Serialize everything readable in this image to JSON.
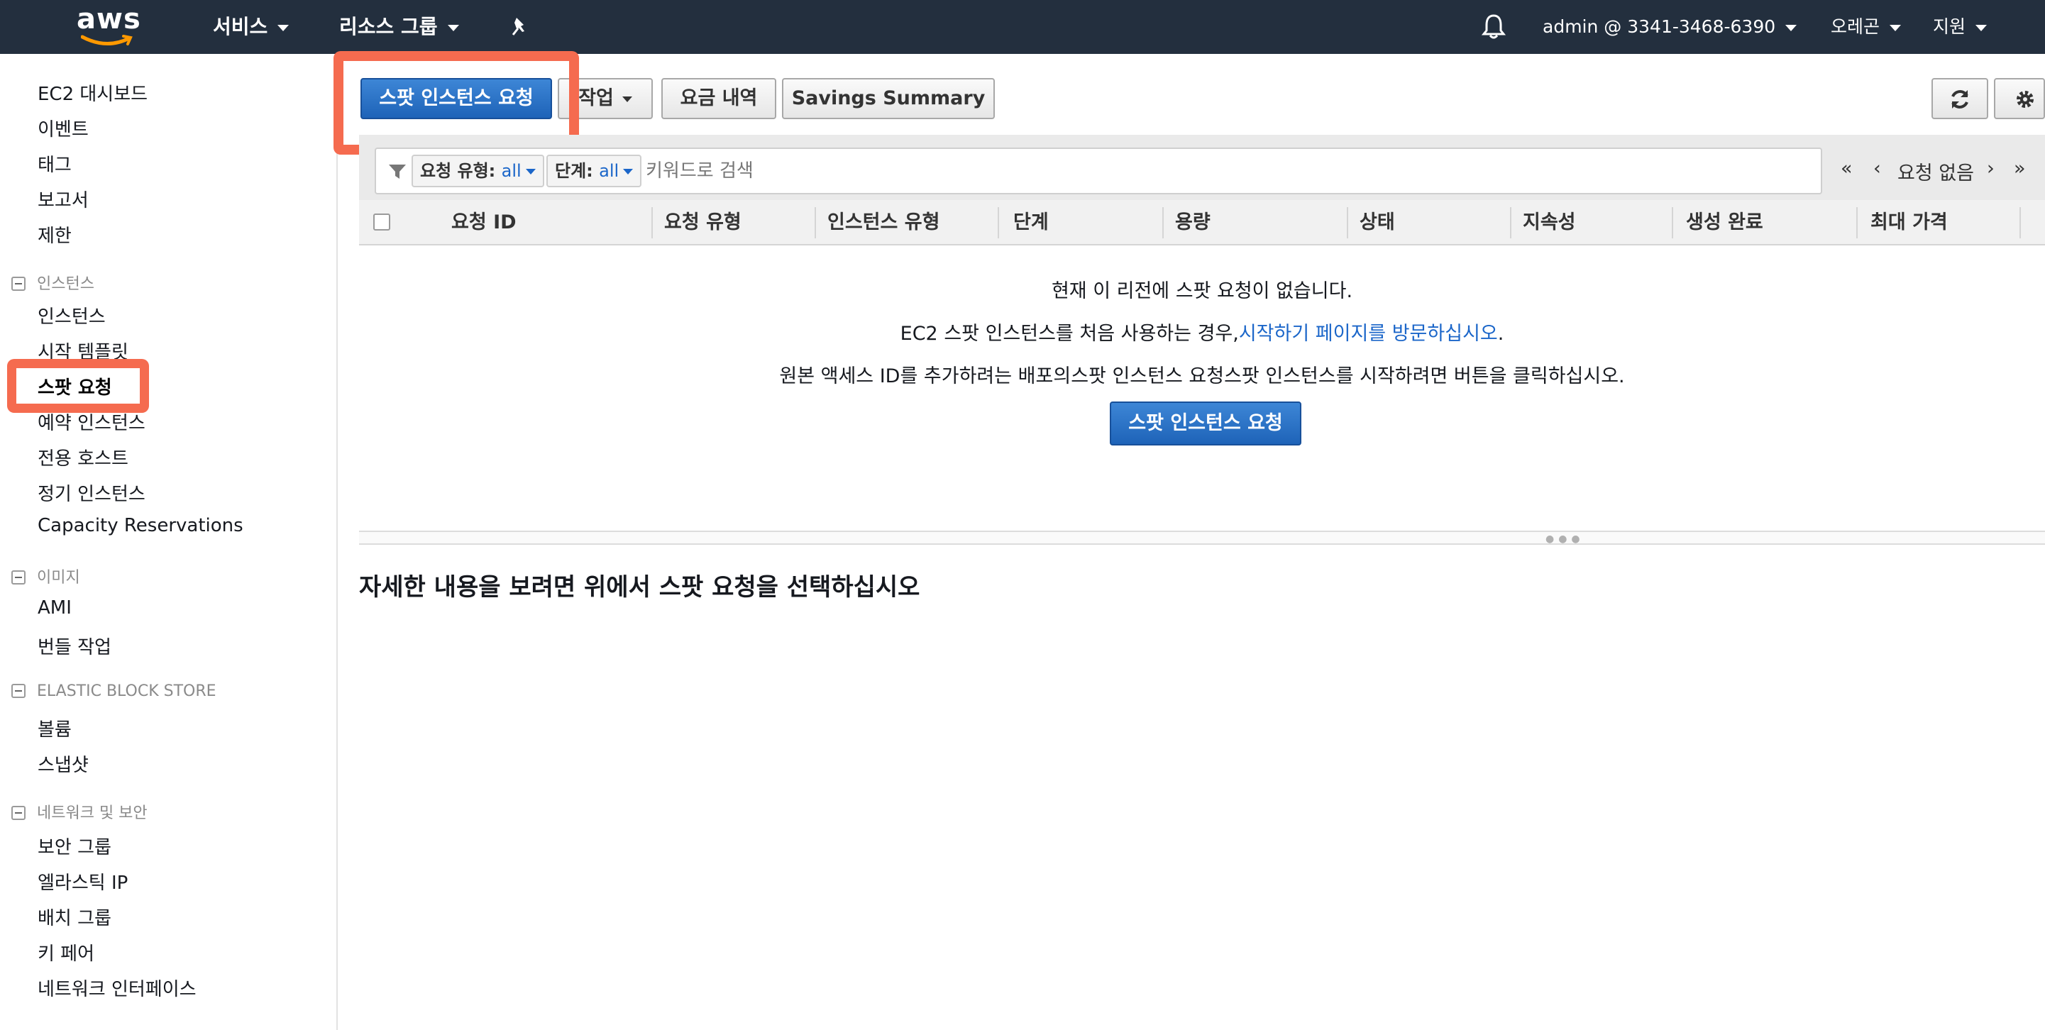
{
  "topnav": {
    "logo": "aws",
    "services": "서비스",
    "resource_groups": "리소스 그룹",
    "account": "admin @ 3341-3468-6390",
    "region": "오레곤",
    "support": "지원"
  },
  "sidebar": {
    "top_links": [
      "EC2 대시보드",
      "이벤트",
      "태그",
      "보고서",
      "제한"
    ],
    "sections": [
      {
        "title": "인스턴스",
        "items": [
          "인스턴스",
          "시작 템플릿",
          "스팟 요청",
          "예약 인스턴스",
          "전용 호스트",
          "정기 인스턴스",
          "Capacity Reservations"
        ]
      },
      {
        "title": "이미지",
        "items": [
          "AMI",
          "번들 작업"
        ]
      },
      {
        "title": "ELASTIC BLOCK STORE",
        "items": [
          "볼륨",
          "스냅샷"
        ]
      },
      {
        "title": "네트워크 및 보안",
        "items": [
          "보안 그룹",
          "엘라스틱 IP",
          "배치 그룹",
          "키 페어",
          "네트워크 인터페이스"
        ]
      }
    ],
    "active_item": "스팟 요청"
  },
  "toolbar": {
    "request_button": "스팟 인스턴스 요청",
    "actions_button": "작업",
    "pricing_button": "요금 내역",
    "savings_button": "Savings Summary"
  },
  "filter": {
    "request_type_label": "요청 유형:",
    "request_type_value": "all",
    "state_label": "단계:",
    "state_value": "all",
    "search_placeholder": "키워드로 검색"
  },
  "pager": {
    "first": "«",
    "prev": "‹",
    "status": "요청 없음",
    "next": "›",
    "last": "»"
  },
  "table": {
    "columns": [
      "요청 ID",
      "요청 유형",
      "인스턴스 유형",
      "단계",
      "용량",
      "상태",
      "지속성",
      "생성 완료",
      "최대 가격"
    ]
  },
  "empty_state": {
    "line1": "현재 이 리전에 스팟 요청이 없습니다.",
    "line2_prefix": "EC2 스팟 인스턴스를 처음 사용하는 경우,",
    "line2_link": "시작하기 페이지를 방문하십시오",
    "line2_suffix": ".",
    "line3": "원본 액세스 ID를 추가하려는 배포의스팟 인스턴스 요청스팟 인스턴스를 시작하려면 버튼을 클릭하십시오.",
    "button": "스팟 인스턴스 요청"
  },
  "detail": {
    "title": "자세한 내용을 보려면 위에서 스팟 요청을 선택하십시오"
  },
  "colors": {
    "nav_bg": "#232f3e",
    "primary": "#1e63b8",
    "highlight": "#f56b4f",
    "link": "#1b66c9"
  }
}
